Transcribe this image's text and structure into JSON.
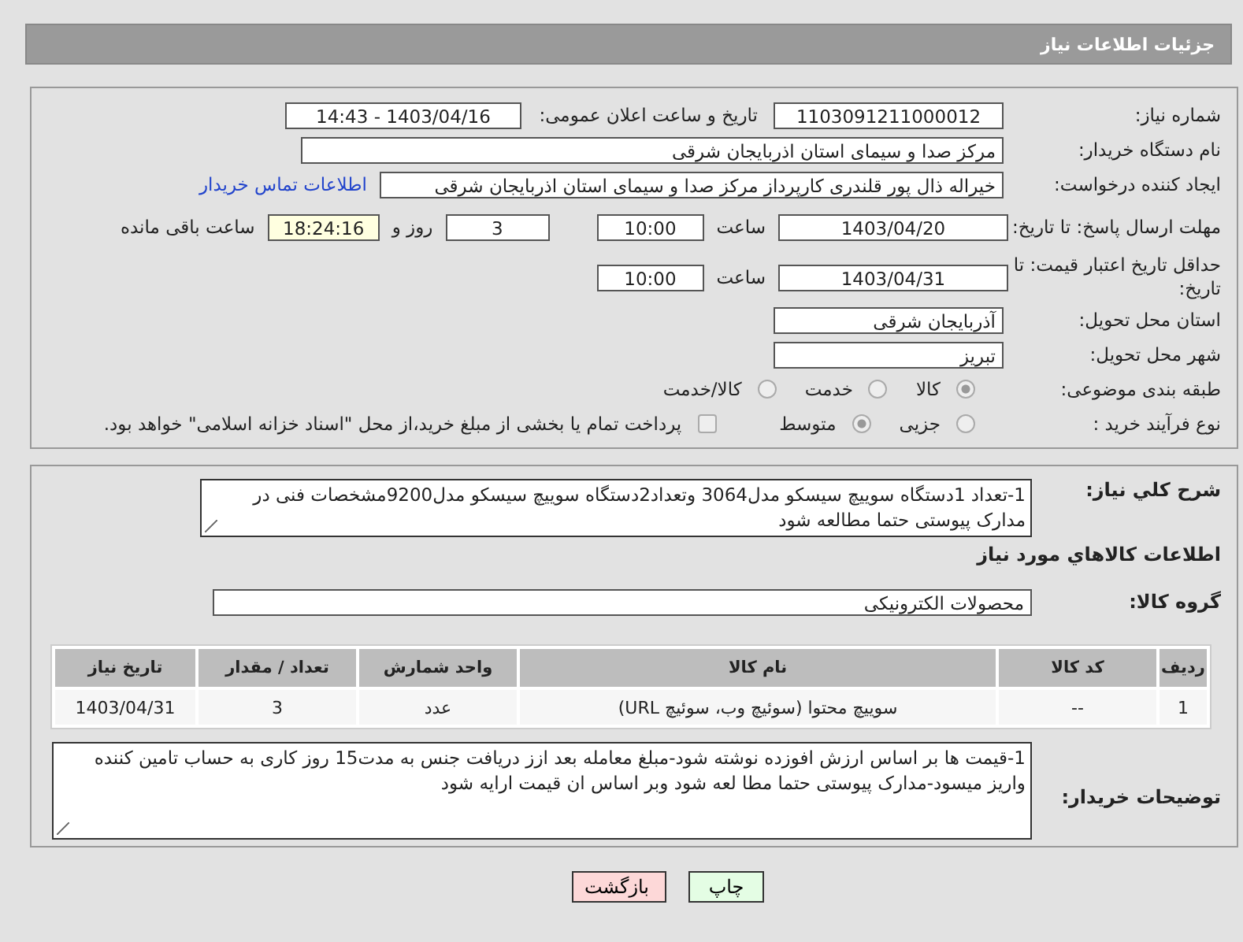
{
  "header": {
    "title": "جزئیات اطلاعات نیاز"
  },
  "need_number": {
    "label": "شماره نیاز:",
    "value": "1103091211000012"
  },
  "announce": {
    "label": "تاریخ و ساعت اعلان عمومی:",
    "value": "1403/04/16 - 14:43"
  },
  "buyer_org": {
    "label": "نام دستگاه خریدار:",
    "value": "مرکز صدا و سیمای استان اذربایجان شرقی"
  },
  "requester": {
    "label": "ایجاد کننده درخواست:",
    "value": "خیراله  ذال پور قلندری کارپرداز مرکز صدا و سیمای استان اذربایجان شرقی",
    "link": "اطلاعات تماس خریدار"
  },
  "reply_deadline": {
    "label": "مهلت ارسال پاسخ: تا تاریخ:",
    "date": "1403/04/20",
    "time_label": "ساعت",
    "time": "10:00",
    "days": "3",
    "days_label": "روز و",
    "remaining": "18:24:16",
    "remaining_label": "ساعت باقی مانده"
  },
  "price_validity": {
    "label": "حداقل تاریخ اعتبار قیمت: تا تاریخ:",
    "date": "1403/04/31",
    "time_label": "ساعت",
    "time": "10:00"
  },
  "province": {
    "label": "استان محل تحویل:",
    "value": "آذربایجان شرقی"
  },
  "city": {
    "label": "شهر محل تحویل:",
    "value": "تبریز"
  },
  "category": {
    "label": "طبقه بندی موضوعی:",
    "options": [
      {
        "label": "کالا",
        "selected": true
      },
      {
        "label": "خدمت",
        "selected": false
      },
      {
        "label": "کالا/خدمت",
        "selected": false
      }
    ]
  },
  "process": {
    "label": "نوع فرآیند خرید :",
    "options": [
      {
        "label": "جزیی",
        "selected": false
      },
      {
        "label": "متوسط",
        "selected": true
      }
    ],
    "treasury": {
      "label": "پرداخت تمام یا بخشی از مبلغ خرید،از محل \"اسناد خزانه اسلامی\" خواهد بود.",
      "checked": false
    }
  },
  "summary": {
    "label": "شرح کلي نياز:",
    "value": "1-تعداد 1دستگاه سوییچ سیسکو مدل3064 وتعداد2دستگاه سوییچ سیسکو مدل9200مشخصات فنی در مدارک پیوستی حتما مطالعه شود"
  },
  "goods_heading": "اطلاعات کالاهاي مورد نياز",
  "goods_group": {
    "label": "گروه کالا:",
    "value": "محصولات الکترونیکی"
  },
  "table": {
    "columns": [
      "ردیف",
      "کد کالا",
      "نام کالا",
      "واحد شمارش",
      "تعداد / مقدار",
      "تاریخ نیاز"
    ],
    "rows": [
      [
        "1",
        "--",
        "سوییچ محتوا (سوئیچ وب، سوئیچ URL)",
        "عدد",
        "3",
        "1403/04/31"
      ]
    ]
  },
  "buyer_notes": {
    "label": "توضیحات خریدار:",
    "value": "1-قیمت ها بر اساس ارزش افوزده نوشته شود-مبلغ معامله بعد ازز دریافت جنس به مدت15 روز کاری به حساب تامین کننده واریز میسود-مدارک پیوستی حتما مطا لعه شود وبر اساس ان قیمت ارایه شود"
  },
  "buttons": {
    "print": "چاپ",
    "back": "بازگشت"
  }
}
